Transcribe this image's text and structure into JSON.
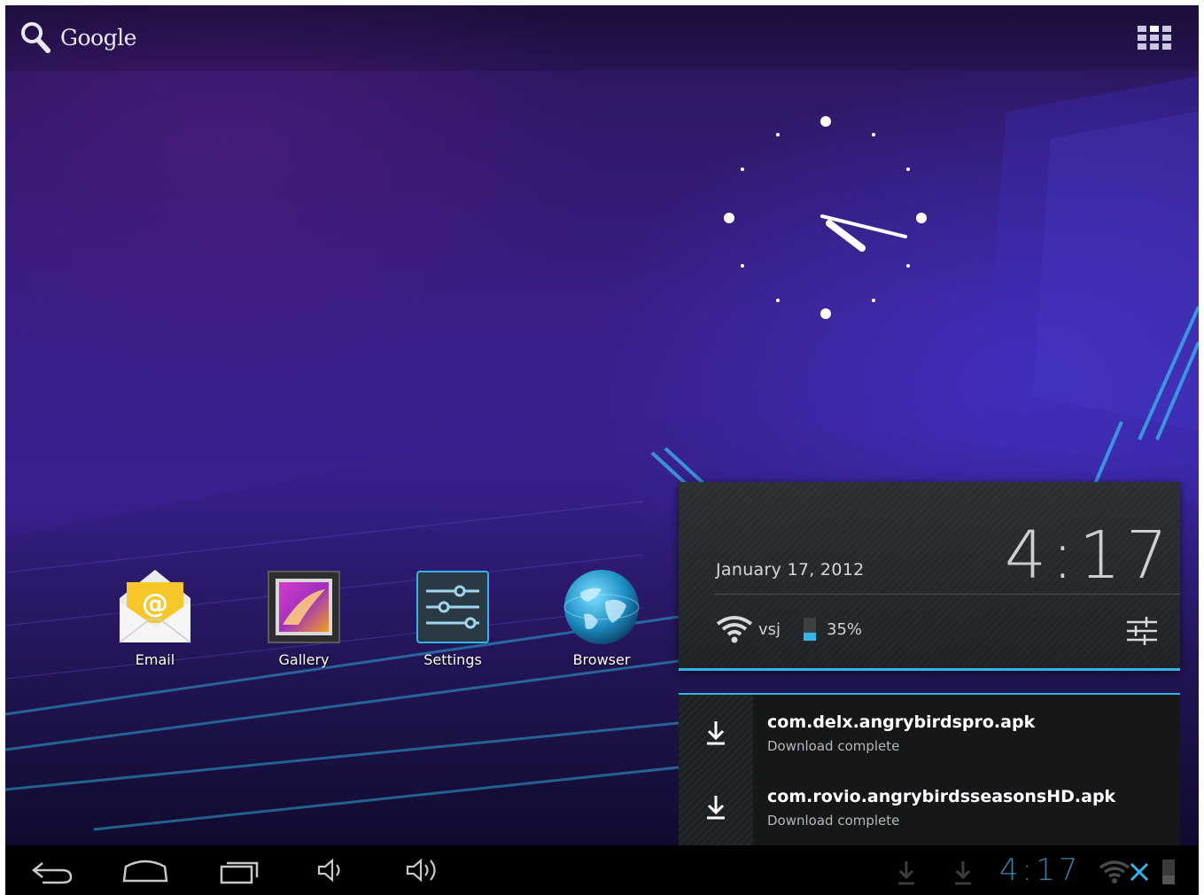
{
  "search": {
    "label": "Google"
  },
  "apps": [
    {
      "id": "email",
      "label": "Email"
    },
    {
      "id": "gallery",
      "label": "Gallery"
    },
    {
      "id": "settings",
      "label": "Settings"
    },
    {
      "id": "browser",
      "label": "Browser"
    }
  ],
  "notification_panel": {
    "date": "January 17, 2012",
    "time": "4:17",
    "wifi_name": "vsj",
    "battery": "35%",
    "notifications": [
      {
        "title": "com.delx.angrybirdspro.apk",
        "subtitle": "Download complete"
      },
      {
        "title": "com.rovio.angrybirdsseasonsHD.apk",
        "subtitle": "Download complete"
      }
    ]
  },
  "system_bar": {
    "time": "4:17"
  },
  "colors": {
    "accent": "#33b5e5",
    "status_time": "#3a7ea3",
    "wallpaper": "#3a1f8e"
  }
}
